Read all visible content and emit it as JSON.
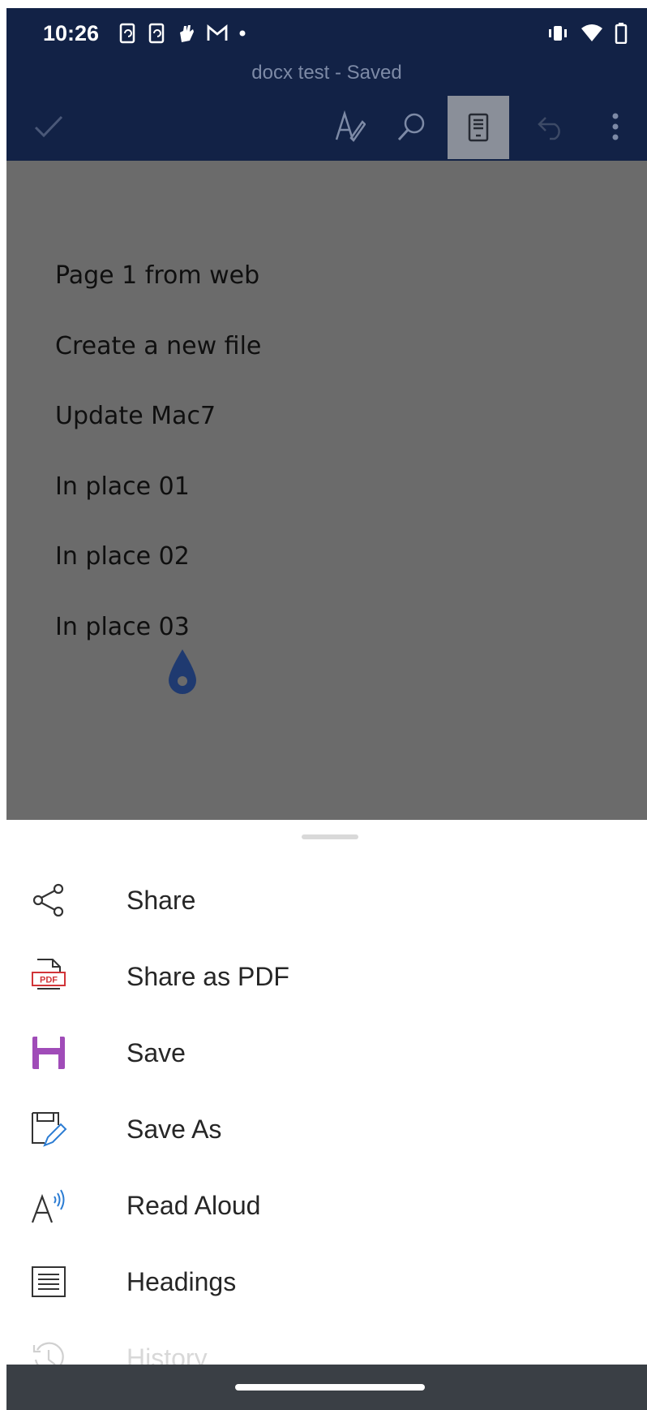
{
  "status_bar": {
    "time": "10:26"
  },
  "header": {
    "title": "docx test - Saved"
  },
  "document": {
    "lines": [
      "Page 1 from web",
      "Create a new file",
      "Update Mac7",
      "In place 01",
      "In place 02",
      "In place 03"
    ]
  },
  "menu": {
    "items": [
      {
        "label": "Share",
        "icon": "share-icon"
      },
      {
        "label": "Share as PDF",
        "icon": "pdf-icon"
      },
      {
        "label": "Save",
        "icon": "save-icon"
      },
      {
        "label": "Save As",
        "icon": "save-as-icon"
      },
      {
        "label": "Read Aloud",
        "icon": "read-aloud-icon"
      },
      {
        "label": "Headings",
        "icon": "headings-icon"
      },
      {
        "label": "History",
        "icon": "history-icon"
      }
    ]
  },
  "colors": {
    "header_bg": "#122246",
    "doc_dim": "#6b6b6b",
    "save_purple": "#a04cb8",
    "pdf_red": "#d13438",
    "save_as_blue": "#2b7cd3",
    "cursor_blue": "#1f3a70"
  }
}
